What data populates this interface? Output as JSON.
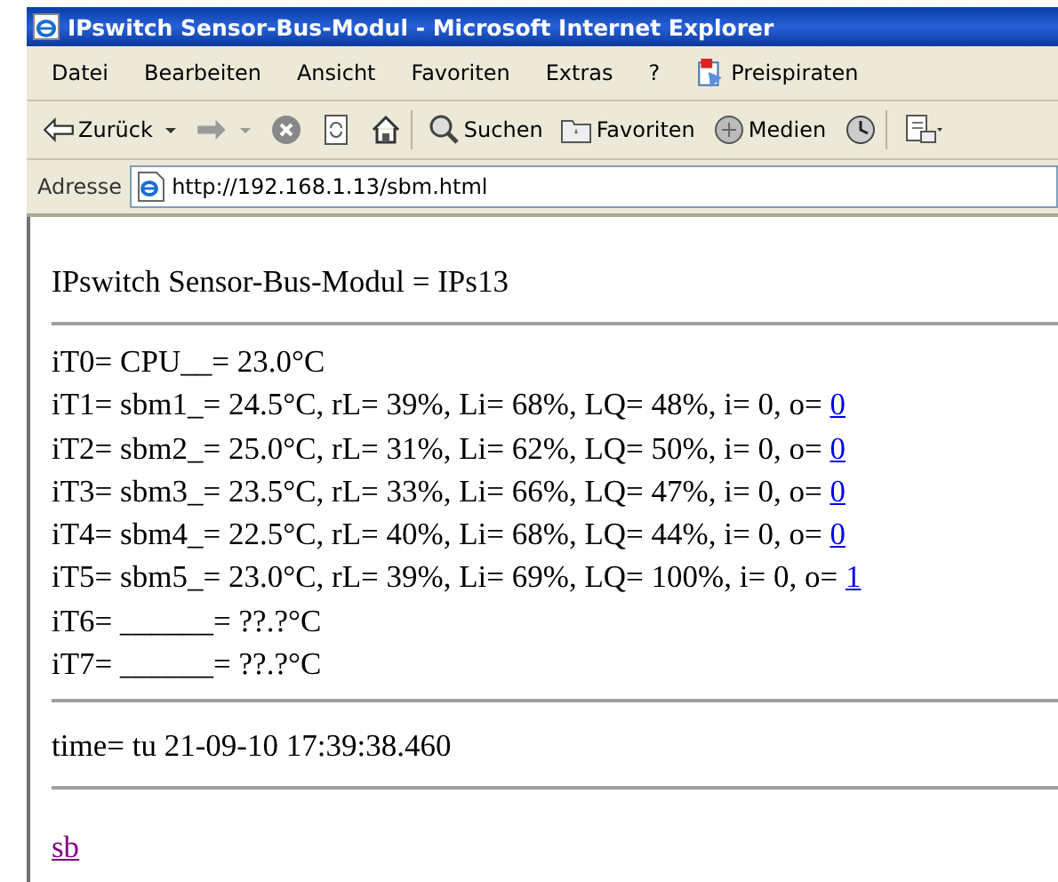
{
  "window": {
    "title": "IPswitch Sensor-Bus-Modul - Microsoft Internet Explorer"
  },
  "menu": [
    {
      "label": "Datei"
    },
    {
      "label": "Bearbeiten"
    },
    {
      "label": "Ansicht"
    },
    {
      "label": "Favoriten"
    },
    {
      "label": "Extras"
    },
    {
      "label": "?"
    },
    {
      "label": "Preispiraten",
      "kind": "plugin"
    }
  ],
  "toolbar": [
    {
      "kind": "back",
      "label": "Zurück"
    },
    {
      "kind": "forward"
    },
    {
      "kind": "stop"
    },
    {
      "kind": "refresh"
    },
    {
      "kind": "home"
    },
    {
      "kind": "search",
      "label": "Suchen"
    },
    {
      "kind": "favorites",
      "label": "Favoriten"
    },
    {
      "kind": "media",
      "label": "Medien"
    },
    {
      "kind": "history"
    },
    {
      "kind": "mail"
    }
  ],
  "address": {
    "label": "Adresse",
    "value": "http://192.168.1.13/sbm.html"
  },
  "page": {
    "heading": "IPswitch Sensor-Bus-Modul = IPs13",
    "sensors": [
      {
        "text": "iT0= CPU__= 23.0°C"
      },
      {
        "text": "iT1= sbm1_= 24.5°C, rL= 39%, Li= 68%, LQ= 48%, i= 0, o= ",
        "output": "0"
      },
      {
        "text": "iT2= sbm2_= 25.0°C, rL= 31%, Li= 62%, LQ= 50%, i= 0, o= ",
        "output": "0"
      },
      {
        "text": "iT3= sbm3_= 23.5°C, rL= 33%, Li= 66%, LQ= 47%, i= 0, o= ",
        "output": "0"
      },
      {
        "text": "iT4= sbm4_= 22.5°C, rL= 40%, Li= 68%, LQ= 44%, i= 0, o= ",
        "output": "0"
      },
      {
        "text": "iT5= sbm5_= 23.0°C, rL= 39%, Li= 69%, LQ= 100%, i= 0, o= ",
        "output": "1"
      },
      {
        "text": "iT6= ______= ??.?°C"
      },
      {
        "text": "iT7= ______= ??.?°C"
      }
    ],
    "time": "time= tu 21-09-10 17:39:38.460",
    "link": {
      "label": "sb",
      "visited": true
    }
  }
}
